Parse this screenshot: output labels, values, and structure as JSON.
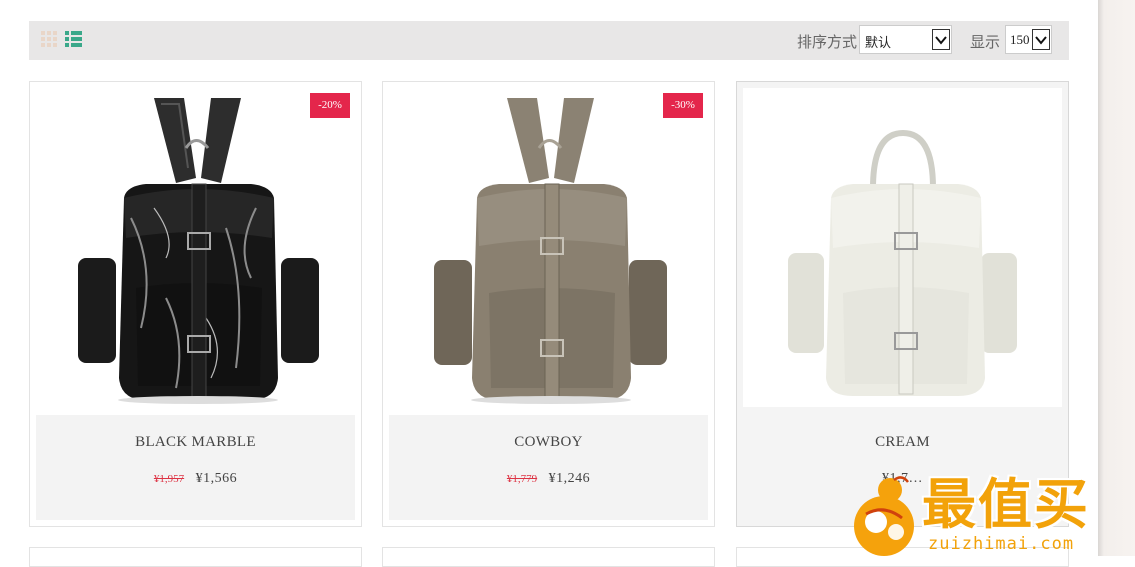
{
  "toolbar": {
    "grid_icon": "grid-view-icon",
    "list_icon": "list-view-icon",
    "sort_label": "排序方式",
    "sort_value": "默认",
    "show_label": "显示",
    "show_value": "150"
  },
  "products": [
    {
      "name": "BLACK MARBLE",
      "badge": "-20%",
      "old_price": "¥1,957",
      "price": "¥1,566"
    },
    {
      "name": "COWBOY",
      "badge": "-30%",
      "old_price": "¥1,779",
      "price": "¥1,246"
    },
    {
      "name": "CREAM",
      "badge": "",
      "old_price": "",
      "price": "¥1,7…"
    }
  ],
  "watermark": {
    "title": "最值买",
    "url": "zuizhimai.com"
  },
  "colors": {
    "badge": "#e4264b",
    "old_price": "#d34",
    "list_icon": "#3aa88a",
    "logo": "#f2a20a"
  }
}
